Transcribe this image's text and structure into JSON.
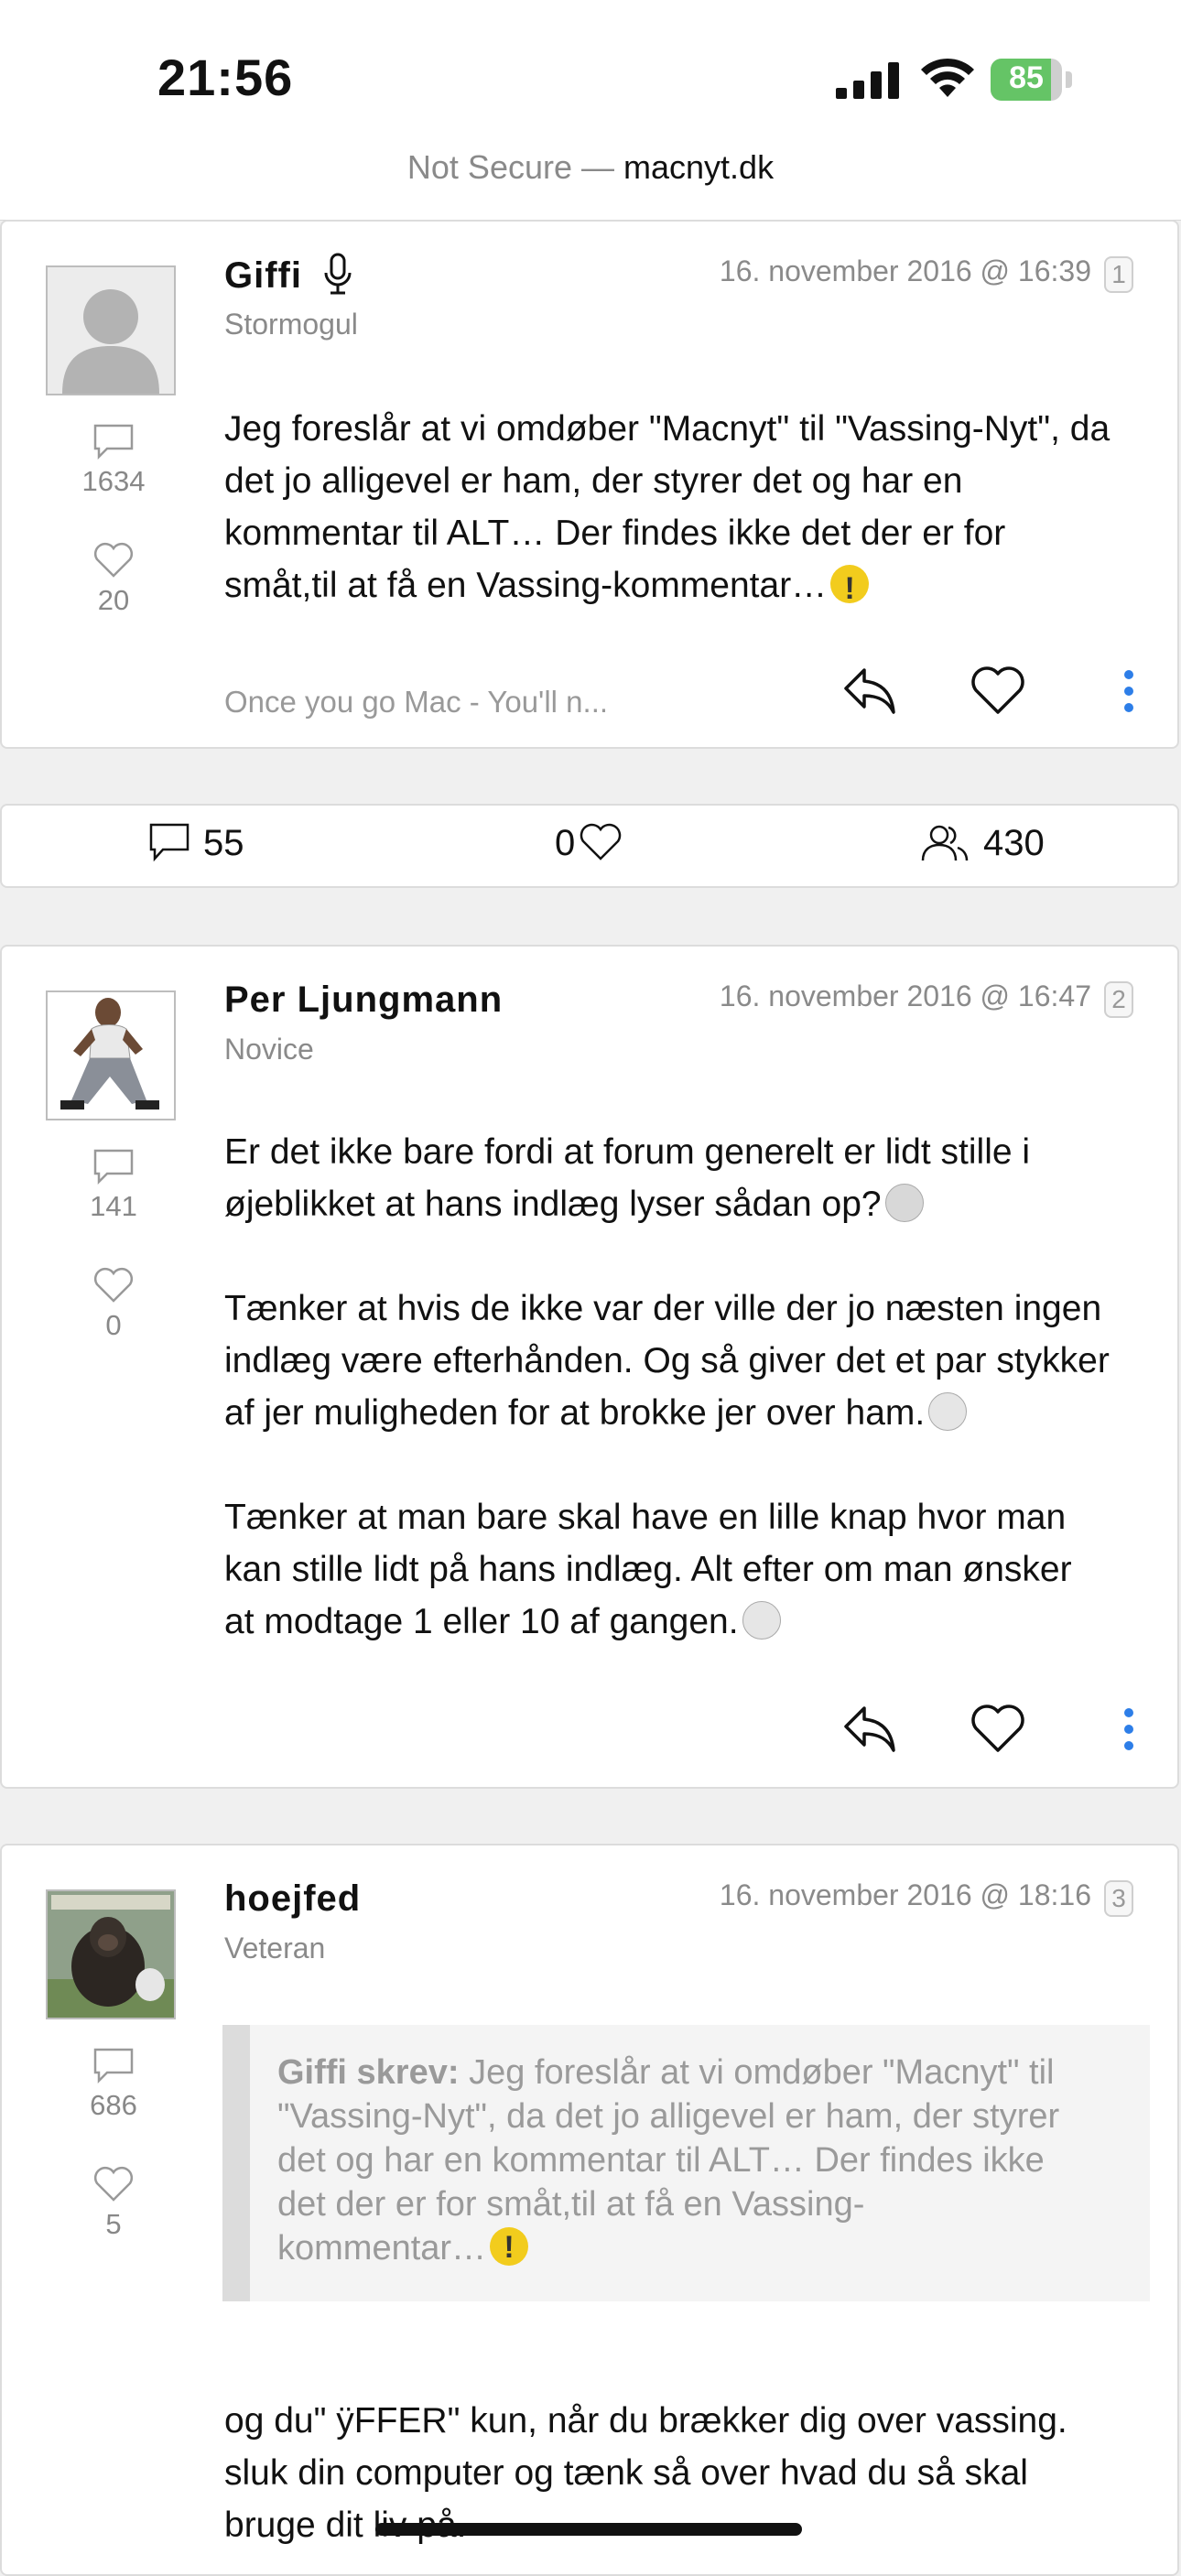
{
  "status_bar": {
    "time": "21:56",
    "battery_percent": "85",
    "battery_level": 0.85
  },
  "url_bar": {
    "prefix": "Not Secure —",
    "host": "macnyt.dk"
  },
  "posts": [
    {
      "author": "Giffi",
      "rank": "Stormogul",
      "date": "16. november 2016 @ 16:39",
      "number": "1",
      "comments": "1634",
      "likes": "20",
      "body": [
        "Jeg foreslår at vi omdøber \"Macnyt\" til \"Vassing-Nyt\", da",
        "det jo alligevel er ham, der styrer det og har en",
        "kommentar til ALT… Der findes ikke det der er for",
        "småt,til at få en Vassing-kommentar…"
      ],
      "signature": "Once you go Mac - You'll n..."
    },
    {
      "author": "Per Ljungmann",
      "rank": "Novice",
      "date": "16. november 2016 @ 16:47",
      "number": "2",
      "comments": "141",
      "likes": "0",
      "body": [
        "Er det ikke bare fordi at forum generelt er lidt stille i",
        "øjeblikket at hans indlæg lyser sådan op?",
        "Tænker at hvis de ikke var der ville der jo næsten ingen",
        "indlæg være efterhånden. Og så giver det et par stykker",
        "af jer muligheden for at brokke jer over ham.",
        "Tænker at man bare skal have en lille knap hvor man",
        "kan stille lidt på hans indlæg. Alt efter om man ønsker",
        "at modtage 1 eller 10 af gangen."
      ]
    },
    {
      "author": "hoejfed",
      "rank": "Veteran",
      "date": "16. november 2016 @ 18:16",
      "number": "3",
      "comments": "686",
      "likes": "5",
      "quote": {
        "author": "Giffi skrev:",
        "lines": [
          " Jeg foreslår at vi omdøber \"Macnyt\" til",
          "\"Vassing-Nyt\", da det jo alligevel er ham, der styrer",
          "det og har en kommentar til ALT… Der findes ikke",
          "det der er for småt,til at få en Vassing-",
          "kommentar…"
        ]
      },
      "body": [
        "og du\" ÿFFER\" kun, når du brækker dig over vassing.",
        "sluk din computer og tænk så over hvad du så skal",
        "bruge dit liv på."
      ]
    }
  ],
  "thread_stats": {
    "replies": "55",
    "likes": "0",
    "views": "430"
  }
}
